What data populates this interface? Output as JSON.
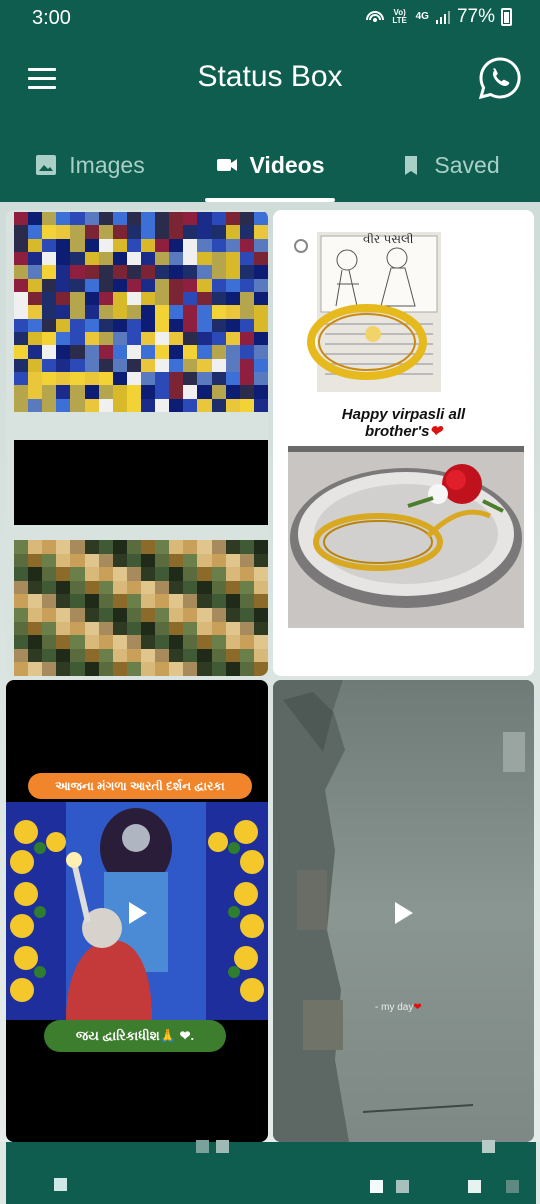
{
  "status_bar": {
    "time": "3:00",
    "volte": "Vo) LTE",
    "network": "4G",
    "battery": "77%"
  },
  "app_bar": {
    "title": "Status Box",
    "menu_icon": "hamburger-menu-icon",
    "whatsapp_icon": "whatsapp-icon"
  },
  "tabs": [
    {
      "label": "Images",
      "icon": "image-icon",
      "active": false
    },
    {
      "label": "Videos",
      "icon": "videocam-icon",
      "active": true
    },
    {
      "label": "Saved",
      "icon": "bookmark-icon",
      "active": false
    }
  ],
  "grid": {
    "card_2": {
      "book_heading": "વીર પસલી",
      "caption_line1": "Happy virpasli all",
      "caption_line2": "brother's",
      "caption_heart": "❤"
    },
    "card_3": {
      "banner": "આજના મંગળા આરતી દર્શન દ્વારકા",
      "pill": "જય દ્વારિકાધીશ🙏 ❤."
    },
    "card_4": {
      "caption": "- my day",
      "caption_heart": "❤"
    }
  },
  "colors": {
    "primary": "#0e5d4f",
    "tab_inactive": "#a9cfc6",
    "accent_orange": "#f0852c"
  }
}
